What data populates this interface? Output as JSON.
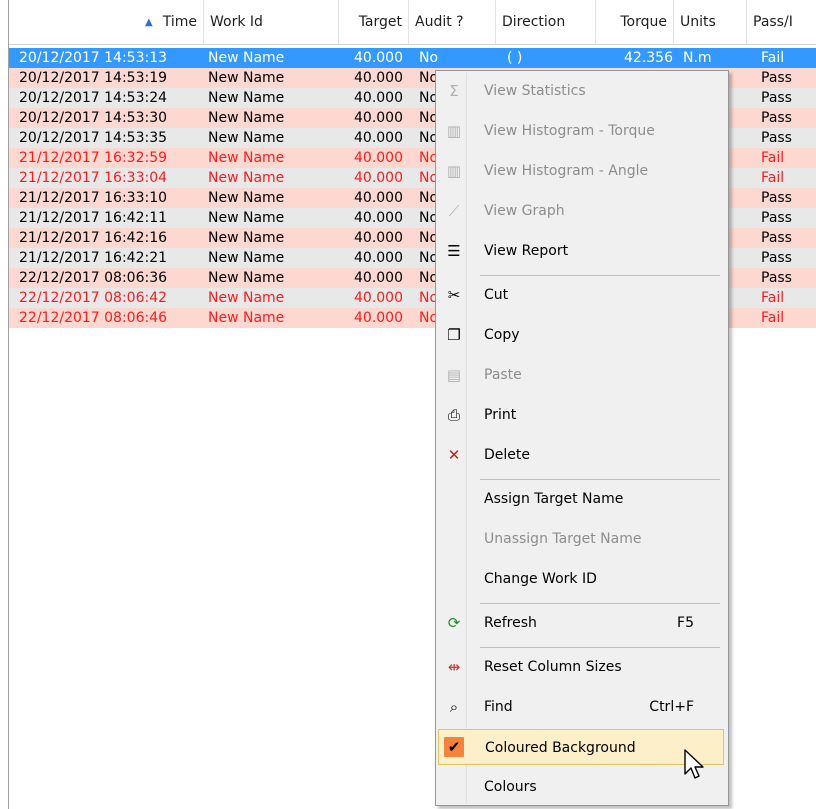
{
  "columns": [
    {
      "key": "time",
      "label": "Time",
      "sorted": true
    },
    {
      "key": "work_id",
      "label": "Work Id"
    },
    {
      "key": "target",
      "label": "Target"
    },
    {
      "key": "audit",
      "label": "Audit ?"
    },
    {
      "key": "direction",
      "label": "Direction"
    },
    {
      "key": "torque",
      "label": "Torque"
    },
    {
      "key": "units",
      "label": "Units"
    },
    {
      "key": "pass",
      "label": "Pass/I"
    }
  ],
  "rows": [
    {
      "time": "20/12/2017 14:53:13",
      "work_id": "New Name",
      "target": "40.000",
      "audit": "No",
      "direction": "( )",
      "torque": "42.356",
      "units": "N.m",
      "pass": "Fail",
      "style": "sel"
    },
    {
      "time": "20/12/2017 14:53:19",
      "work_id": "New Name",
      "target": "40.000",
      "audit": "No",
      "pass": "Pass",
      "style": "pink"
    },
    {
      "time": "20/12/2017 14:53:24",
      "work_id": "New Name",
      "target": "40.000",
      "audit": "No",
      "pass": "Pass",
      "style": "grey"
    },
    {
      "time": "20/12/2017 14:53:30",
      "work_id": "New Name",
      "target": "40.000",
      "audit": "No",
      "pass": "Pass",
      "style": "pink"
    },
    {
      "time": "20/12/2017 14:53:35",
      "work_id": "New Name",
      "target": "40.000",
      "audit": "No",
      "pass": "Pass",
      "style": "grey"
    },
    {
      "time": "21/12/2017 16:32:59",
      "work_id": "New Name",
      "target": "40.000",
      "audit": "No",
      "pass": "Fail",
      "style": "pink red"
    },
    {
      "time": "21/12/2017 16:33:04",
      "work_id": "New Name",
      "target": "40.000",
      "audit": "No",
      "pass": "Fail",
      "style": "grey red"
    },
    {
      "time": "21/12/2017 16:33:10",
      "work_id": "New Name",
      "target": "40.000",
      "audit": "No",
      "pass": "Pass",
      "style": "pink"
    },
    {
      "time": "21/12/2017 16:42:11",
      "work_id": "New Name",
      "target": "40.000",
      "audit": "No",
      "pass": "Pass",
      "style": "grey"
    },
    {
      "time": "21/12/2017 16:42:16",
      "work_id": "New Name",
      "target": "40.000",
      "audit": "No",
      "pass": "Pass",
      "style": "pink"
    },
    {
      "time": "21/12/2017 16:42:21",
      "work_id": "New Name",
      "target": "40.000",
      "audit": "No",
      "pass": "Pass",
      "style": "grey"
    },
    {
      "time": "22/12/2017 08:06:36",
      "work_id": "New Name",
      "target": "40.000",
      "audit": "No",
      "pass": "Pass",
      "style": "pink"
    },
    {
      "time": "22/12/2017 08:06:42",
      "work_id": "New Name",
      "target": "40.000",
      "audit": "No",
      "pass": "Fail",
      "style": "grey red"
    },
    {
      "time": "22/12/2017 08:06:46",
      "work_id": "New Name",
      "target": "40.000",
      "audit": "No",
      "pass": "Fail",
      "style": "pink red"
    }
  ],
  "menu": [
    {
      "type": "item",
      "label": "View Statistics",
      "icon": "sigma-icon",
      "glyph": "Σ",
      "disabled": true
    },
    {
      "type": "item",
      "label": "View Histogram - Torque",
      "icon": "histogram-icon",
      "glyph": "▥",
      "disabled": true
    },
    {
      "type": "item",
      "label": "View Histogram - Angle",
      "icon": "histogram-icon",
      "glyph": "▥",
      "disabled": true
    },
    {
      "type": "item",
      "label": "View Graph",
      "icon": "graph-icon",
      "glyph": "⟋",
      "disabled": true
    },
    {
      "type": "item",
      "label": "View Report",
      "icon": "report-icon",
      "glyph": "☰",
      "disabled": false
    },
    {
      "type": "sep"
    },
    {
      "type": "item",
      "label": "Cut",
      "icon": "scissors-icon",
      "glyph": "✂",
      "disabled": false
    },
    {
      "type": "item",
      "label": "Copy",
      "icon": "copy-icon",
      "glyph": "❐",
      "disabled": false
    },
    {
      "type": "item",
      "label": "Paste",
      "icon": "paste-icon",
      "glyph": "▤",
      "disabled": true
    },
    {
      "type": "item",
      "label": "Print",
      "icon": "printer-icon",
      "glyph": "⎙",
      "disabled": false
    },
    {
      "type": "item",
      "label": "Delete",
      "icon": "delete-icon",
      "glyph": "✕",
      "disabled": false,
      "color": "#c81e1e"
    },
    {
      "type": "sep"
    },
    {
      "type": "item",
      "label": "Assign Target Name",
      "disabled": false
    },
    {
      "type": "item",
      "label": "Unassign Target Name",
      "disabled": true
    },
    {
      "type": "item",
      "label": "Change Work ID",
      "disabled": false
    },
    {
      "type": "sep"
    },
    {
      "type": "item",
      "label": "Refresh",
      "shortcut": "F5",
      "icon": "refresh-icon",
      "glyph": "⟳",
      "disabled": false,
      "color": "#2c8a2c"
    },
    {
      "type": "sep"
    },
    {
      "type": "item",
      "label": "Reset Column Sizes",
      "icon": "column-resize-icon",
      "glyph": "⇹",
      "disabled": false,
      "color": "#c0392b"
    },
    {
      "type": "item",
      "label": "Find",
      "shortcut": "Ctrl+F",
      "icon": "search-icon",
      "glyph": "⌕",
      "disabled": false
    },
    {
      "type": "item",
      "label": "Coloured Background",
      "icon": "check-icon",
      "glyph": "✔",
      "disabled": false,
      "highlighted": true
    },
    {
      "type": "item",
      "label": "Colours",
      "disabled": false
    }
  ],
  "colors": {
    "selected": "#3399ff",
    "pink_row": "#fdd8d0",
    "grey_row": "#e8e8e8",
    "fail_text": "#ff1a1a",
    "highlight": "#fdf0c8",
    "check_bg": "#f6823b"
  }
}
